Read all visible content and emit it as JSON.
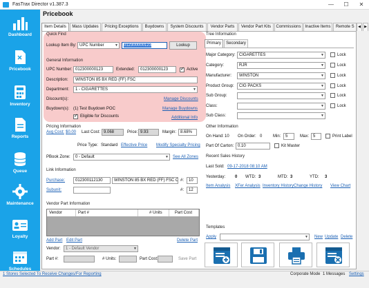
{
  "window": {
    "title": "FasTrax Director v1.387.3",
    "min": "—",
    "max": "☐",
    "close": "✕"
  },
  "sidebar": {
    "items": [
      {
        "label": "Dashboard",
        "icon": "dashboard-icon"
      },
      {
        "label": "Pricebook",
        "icon": "pricebook-icon"
      },
      {
        "label": "Inventory",
        "icon": "calculator-icon"
      },
      {
        "label": "Reports",
        "icon": "document-icon"
      },
      {
        "label": "Queue",
        "icon": "database-icon"
      },
      {
        "label": "Maintenance",
        "icon": "gear-icon"
      },
      {
        "label": "Loyalty",
        "icon": "id-card-icon"
      },
      {
        "label": "Schedules",
        "icon": "calendar-icon"
      }
    ]
  },
  "page": {
    "title": "Pricebook"
  },
  "tabs": [
    "Item Details",
    "Mass Updates",
    "Pricing Exceptions",
    "Buydowns",
    "System Discounts",
    "Vendor Parts",
    "Vendor Part Kits",
    "Commissions",
    "Inactive Items",
    "Remote S"
  ],
  "tab_scroll": {
    "left": "◀",
    "right": "▶"
  },
  "quick_find": {
    "header": "Quick Find",
    "lookup_label": "Lookup Item By:",
    "lookup_mode": "UPC Number",
    "lookup_value": "012300000123",
    "lookup_button": "Lookup"
  },
  "general": {
    "header": "General Information",
    "upc_label": "UPC Number:",
    "upc_value": "012300000123",
    "extended_label": "Extended:",
    "extended_value": "012300000123",
    "active_label": "Active",
    "description_label": "Description:",
    "description_value": "WINSTON 85 BX RED (FF) FSC",
    "department_label": "Department:",
    "department_value": "1 - CIGARETTES",
    "discounts_label": "Discount(s):",
    "manage_discounts": "Manage Discounts",
    "buydowns_label": "Buydown(s):",
    "buydowns_value": "(1) Test Buydown POC",
    "manage_buydowns": "Manage Buydowns",
    "eligible_label": "Eligible for Discounts",
    "additional_info": "Additional Info"
  },
  "pricing": {
    "header": "Pricing Information",
    "avg_cost_label": "Avg Cost:",
    "avg_cost_value": "$0.00",
    "last_cost_label": "Last Cost:",
    "last_cost_value": "9.068",
    "price_label": "Price:",
    "price_value": "9.93",
    "margin_label": "Margin:",
    "margin_value": "8.68%",
    "price_type_label": "Price Type:",
    "price_type_value": "Standard",
    "effective_price": "Effective Price",
    "modify_specialty": "Modify Specialty Pricing",
    "pbook_zone_label": "PBook Zone:",
    "pbook_zone_value": "0 - Default",
    "see_all_zones": "See All Zones"
  },
  "link": {
    "header": "Link Information",
    "purchase_label": "Purchase:",
    "purchase_upc": "012300112130",
    "purchase_desc": "WINSTON 85 BX RED (FF) FSC CT",
    "purchase_qty_label": "#:",
    "purchase_qty": "10",
    "subunit_label": "Subunit:",
    "subunit_qty_label": "#:",
    "subunit_qty": "12"
  },
  "vendor_part": {
    "header": "Vendor Part Information",
    "columns": [
      "Vendor",
      "Part #",
      "# Units",
      "Part Cost"
    ],
    "add_part": "Add Part",
    "edit_part": "Edit Part",
    "delete_part": "Delete Part",
    "vendor_label": "Vendor:",
    "vendor_value": "1 - Default Vendor",
    "part_label": "Part #:",
    "units_label": "# Units:",
    "part_cost_label": "Part Cost:",
    "save_part": "Save Part"
  },
  "tree": {
    "header": "Tree Information",
    "tabs": [
      "Primary",
      "Secondary"
    ],
    "rows": [
      {
        "label": "Major Category:",
        "value": "CIGARETTES",
        "lock": "Lock"
      },
      {
        "label": "Category:",
        "value": "RJR",
        "lock": "Lock"
      },
      {
        "label": "Manufacturer:",
        "value": "WINSTON",
        "lock": "Lock"
      },
      {
        "label": "Product Group:",
        "value": "CIG PACKS",
        "lock": "Lock"
      },
      {
        "label": "Sub Group:",
        "value": "",
        "lock": "Lock"
      },
      {
        "label": "Class:",
        "value": "",
        "lock": "Lock"
      },
      {
        "label": "Sub Class:",
        "value": "",
        "lock": ""
      }
    ]
  },
  "other": {
    "header": "Other Information",
    "on_hand_label": "On Hand:",
    "on_hand_value": "10",
    "on_order_label": "On Order:",
    "on_order_value": "0",
    "min_label": "Min:",
    "min_value": "5",
    "max_label": "Max:",
    "max_value": "5",
    "print_label": "Print Label",
    "part_of_carton_label": "Part Of Carton:",
    "part_of_carton_value": "0.10",
    "kit_master": "Kit Master"
  },
  "sales": {
    "header": "Recent Sales History",
    "last_sold_label": "Last Sold:",
    "last_sold_value": "09-17-2018 08:10 AM",
    "yesterday_label": "Yesterday:",
    "yesterday_value": "0",
    "wtd_label": "WTD:",
    "wtd_value": "3",
    "mtd_label": "MTD:",
    "mtd_value": "3",
    "ytd_label": "YTD:",
    "ytd_value": "3",
    "links": [
      "Item Analysis",
      "XFer Analysis",
      "Inventory History",
      "Change History",
      "View Chart"
    ]
  },
  "templates": {
    "header": "Templates",
    "apply": "Apply",
    "new": "New",
    "update": "Update",
    "delete": "Delete"
  },
  "actions": [
    "add-item-icon",
    "save-icon",
    "print-icon",
    "delete-item-icon"
  ],
  "status": {
    "left": "1 Stores Selected To Receive Changes/For Reporting",
    "mode": "Corporate Mode",
    "messages": "1 Messages",
    "settings": "Settings"
  },
  "colors": {
    "sidebar": "#1aa3e8",
    "highlight": "#f08c8c",
    "link": "#1a5fb4"
  }
}
